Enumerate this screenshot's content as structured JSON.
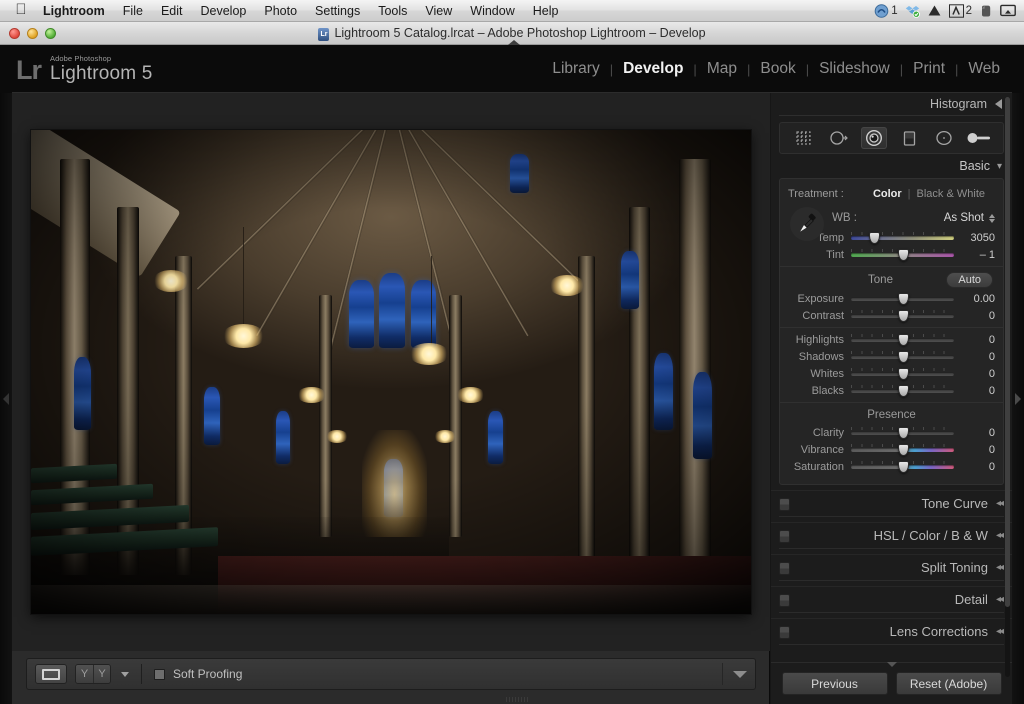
{
  "macbar": {
    "apple": "apple-logo",
    "menus": [
      "Lightroom",
      "File",
      "Edit",
      "Develop",
      "Photo",
      "Settings",
      "Tools",
      "View",
      "Window",
      "Help"
    ],
    "tray": [
      {
        "icon": "creative-cloud-icon",
        "badge": "1"
      },
      {
        "icon": "dropbox-icon",
        "badge": ""
      },
      {
        "icon": "google-drive-icon",
        "badge": ""
      },
      {
        "icon": "adobe-icon",
        "badge": "2"
      },
      {
        "icon": "evernote-icon",
        "badge": ""
      },
      {
        "icon": "airplay-icon",
        "badge": ""
      }
    ]
  },
  "window": {
    "title": "Lightroom 5 Catalog.lrcat – Adobe Photoshop Lightroom – Develop",
    "doc_icon": "lrcat-file-icon"
  },
  "header": {
    "logo_mark": "Lr",
    "logo_sub": "Adobe Photoshop",
    "logo_name": "Lightroom 5",
    "modules": [
      {
        "label": "Library",
        "active": false
      },
      {
        "label": "Develop",
        "active": true
      },
      {
        "label": "Map",
        "active": false
      },
      {
        "label": "Book",
        "active": false
      },
      {
        "label": "Slideshow",
        "active": false
      },
      {
        "label": "Print",
        "active": false
      },
      {
        "label": "Web",
        "active": false
      }
    ],
    "separator": "|"
  },
  "toolbar": {
    "loupe_icon": "loupe-view-icon",
    "before_after_left": "Y",
    "before_after_right": "Y",
    "before_after_caret": "chevron-down-icon",
    "soft_proofing_label": "Soft Proofing",
    "soft_proofing_checked": false,
    "right_caret": "chevron-down-icon"
  },
  "right_panel": {
    "histogram": {
      "title": "Histogram",
      "collapse_icon": "triangle-left-icon"
    },
    "tools": [
      {
        "name": "crop-overlay-tool",
        "active": false
      },
      {
        "name": "spot-removal-tool",
        "active": false
      },
      {
        "name": "red-eye-correction-tool",
        "active": true
      },
      {
        "name": "graduated-filter-tool",
        "active": false
      },
      {
        "name": "radial-filter-tool",
        "active": false
      },
      {
        "name": "adjustment-brush-tool",
        "active": false
      }
    ],
    "basic": {
      "title": "Basic",
      "treatment_label": "Treatment :",
      "treatment_options": [
        {
          "label": "Color",
          "selected": true
        },
        {
          "label": "Black & White",
          "selected": false
        }
      ],
      "wb_label": "WB :",
      "wb_value": "As Shot",
      "eyedropper_icon": "white-balance-selector-icon",
      "wb_sliders": [
        {
          "label": "Temp",
          "value": "3050",
          "pos": 22,
          "track": "temp"
        },
        {
          "label": "Tint",
          "value": "– 1",
          "pos": 50,
          "track": "tint"
        }
      ],
      "tone_label": "Tone",
      "auto_label": "Auto",
      "tone_sliders": [
        {
          "label": "Exposure",
          "value": "0.00",
          "pos": 50,
          "track": "plain"
        },
        {
          "label": "Contrast",
          "value": "0",
          "pos": 50,
          "track": "plain"
        }
      ],
      "detail_sliders": [
        {
          "label": "Highlights",
          "value": "0",
          "pos": 50,
          "track": "plain"
        },
        {
          "label": "Shadows",
          "value": "0",
          "pos": 50,
          "track": "plain"
        },
        {
          "label": "Whites",
          "value": "0",
          "pos": 50,
          "track": "plain"
        },
        {
          "label": "Blacks",
          "value": "0",
          "pos": 50,
          "track": "plain"
        }
      ],
      "presence_label": "Presence",
      "presence_sliders": [
        {
          "label": "Clarity",
          "value": "0",
          "pos": 50,
          "track": "plain"
        },
        {
          "label": "Vibrance",
          "value": "0",
          "pos": 50,
          "track": "vib"
        },
        {
          "label": "Saturation",
          "value": "0",
          "pos": 50,
          "track": "sat"
        }
      ]
    },
    "collapsed_panels": [
      {
        "title": "Tone Curve",
        "enabled": true
      },
      {
        "title": "HSL / Color / B & W",
        "enabled": true
      },
      {
        "title": "Split Toning",
        "enabled": true
      },
      {
        "title": "Detail",
        "enabled": true
      },
      {
        "title": "Lens Corrections",
        "enabled": true
      }
    ],
    "footer": {
      "previous_label": "Previous",
      "reset_label": "Reset (Adobe)"
    }
  },
  "photo": {
    "subject": "gothic-cathedral-interior"
  }
}
